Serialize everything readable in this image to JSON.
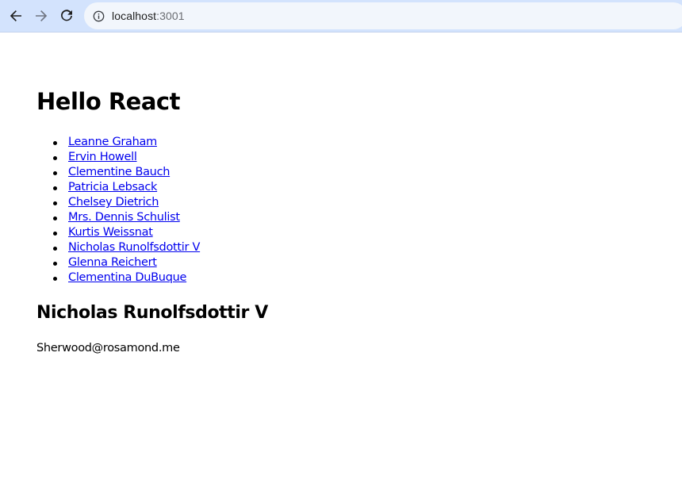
{
  "browser": {
    "url_host": "localhost",
    "url_port": ":3001",
    "icons": {
      "back": "arrow-left-icon",
      "forward": "arrow-right-icon",
      "reload": "reload-icon",
      "info": "info-icon"
    }
  },
  "page": {
    "title": "Hello React",
    "users": [
      {
        "name": "Leanne Graham"
      },
      {
        "name": "Ervin Howell"
      },
      {
        "name": "Clementine Bauch"
      },
      {
        "name": "Patricia Lebsack"
      },
      {
        "name": "Chelsey Dietrich"
      },
      {
        "name": "Mrs. Dennis Schulist"
      },
      {
        "name": "Kurtis Weissnat"
      },
      {
        "name": "Nicholas Runolfsdottir V"
      },
      {
        "name": "Glenna Reichert"
      },
      {
        "name": "Clementina DuBuque"
      }
    ],
    "selected": {
      "name": "Nicholas Runolfsdottir V",
      "email": "Sherwood@rosamond.me"
    },
    "colors": {
      "link": "#0000ee",
      "chrome_bar": "#d3e3fd",
      "omnibox": "#f2f6fc"
    }
  }
}
